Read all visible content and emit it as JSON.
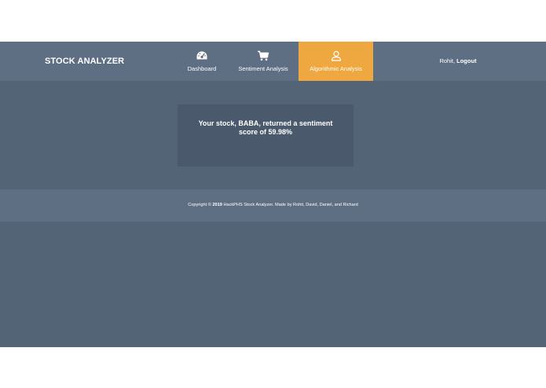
{
  "header": {
    "brand": "STOCK ANALYZER",
    "nav": [
      {
        "label": "Dashboard",
        "icon": "dashboard-gauge-icon"
      },
      {
        "label": "Sentiment Analysis",
        "icon": "shopping-cart-icon"
      },
      {
        "label": "Algorithmic Analysis",
        "icon": "user-icon",
        "active": true
      }
    ],
    "user": {
      "name": "Rohit,",
      "logout_label": "Logout"
    }
  },
  "result": {
    "message": "Your stock, BABA, returned a sentiment score of 59.98%"
  },
  "footer": {
    "prefix": "Copyright ©",
    "year": "2019",
    "suffix": "HackPHS Stock Analyzer. Made by Rohit, David, Daniel, and Richard"
  },
  "colors": {
    "navbar": "#5e6f84",
    "page": "#546477",
    "card": "#4a5a6c",
    "active_tab": "#efa73f",
    "text": "#ffffff"
  }
}
